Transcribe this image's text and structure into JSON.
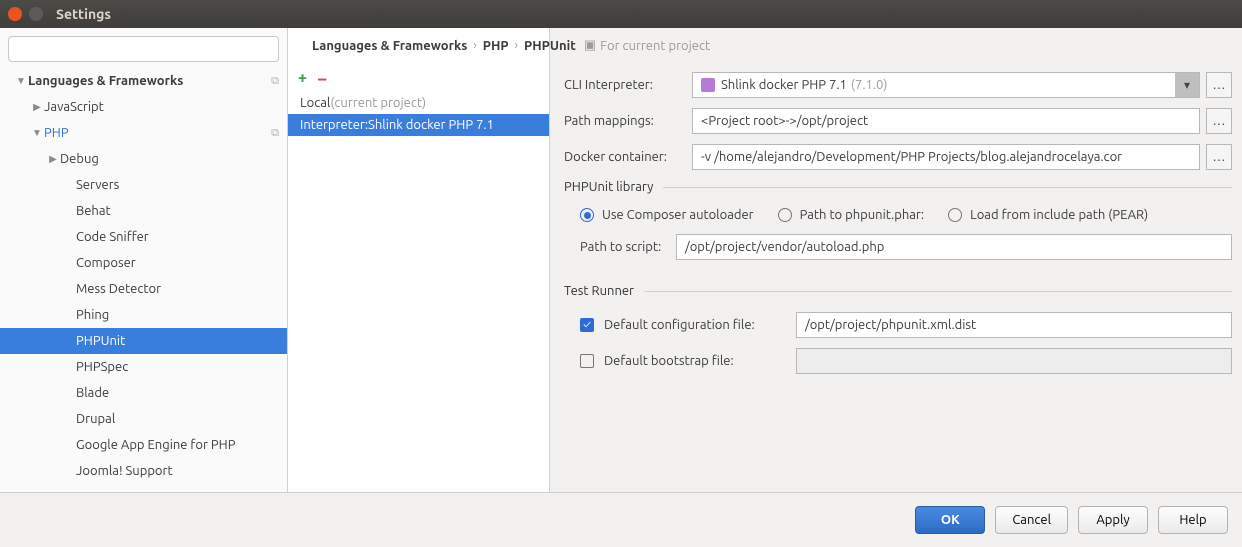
{
  "window": {
    "title": "Settings"
  },
  "breadcrumb": {
    "part1": "Languages & Frameworks",
    "part2": "PHP",
    "part3": "PHPUnit",
    "note": "For current project"
  },
  "sidebar": {
    "search_placeholder": "",
    "items": [
      {
        "label": "Languages & Frameworks",
        "indent": 14,
        "chevron": "down",
        "bold": true,
        "copy": true
      },
      {
        "label": "JavaScript",
        "indent": 30,
        "chevron": "right"
      },
      {
        "label": "PHP",
        "indent": 30,
        "chevron": "down",
        "link": true,
        "copy": true
      },
      {
        "label": "Debug",
        "indent": 46,
        "chevron": "right"
      },
      {
        "label": "Servers",
        "indent": 62
      },
      {
        "label": "Behat",
        "indent": 62
      },
      {
        "label": "Code Sniffer",
        "indent": 62
      },
      {
        "label": "Composer",
        "indent": 62
      },
      {
        "label": "Mess Detector",
        "indent": 62
      },
      {
        "label": "Phing",
        "indent": 62
      },
      {
        "label": "PHPUnit",
        "indent": 62,
        "selected": true
      },
      {
        "label": "PHPSpec",
        "indent": 62
      },
      {
        "label": "Blade",
        "indent": 62
      },
      {
        "label": "Drupal",
        "indent": 62
      },
      {
        "label": "Google App Engine for PHP",
        "indent": 62
      },
      {
        "label": "Joomla! Support",
        "indent": 62
      }
    ]
  },
  "midlist": {
    "items": [
      {
        "prefix": "Local ",
        "suffix": "(current project)",
        "selected": false
      },
      {
        "prefix": "Interpreter: ",
        "suffix": "Shlink docker PHP 7.1",
        "selected": true
      }
    ]
  },
  "form": {
    "cli_label": "CLI Interpreter:",
    "cli_value": "Shlink docker PHP 7.1",
    "cli_version": "(7.1.0)",
    "path_mappings_label": "Path mappings:",
    "path_mappings_value": "<Project root>->/opt/project",
    "docker_label": "Docker container:",
    "docker_value": "-v /home/alejandro/Development/PHP Projects/blog.alejandrocelaya.cor",
    "fieldset1": "PHPUnit library",
    "radio1": "Use Composer autoloader",
    "radio2": "Path to phpunit.phar:",
    "radio3": "Load from include path (PEAR)",
    "script_label": "Path to script:",
    "script_value": "/opt/project/vendor/autoload.php",
    "fieldset2": "Test Runner",
    "check1_label": "Default configuration file:",
    "check1_value": "/opt/project/phpunit.xml.dist",
    "check2_label": "Default bootstrap file:",
    "check2_value": ""
  },
  "footer": {
    "ok": "OK",
    "cancel": "Cancel",
    "apply": "Apply",
    "help": "Help"
  }
}
